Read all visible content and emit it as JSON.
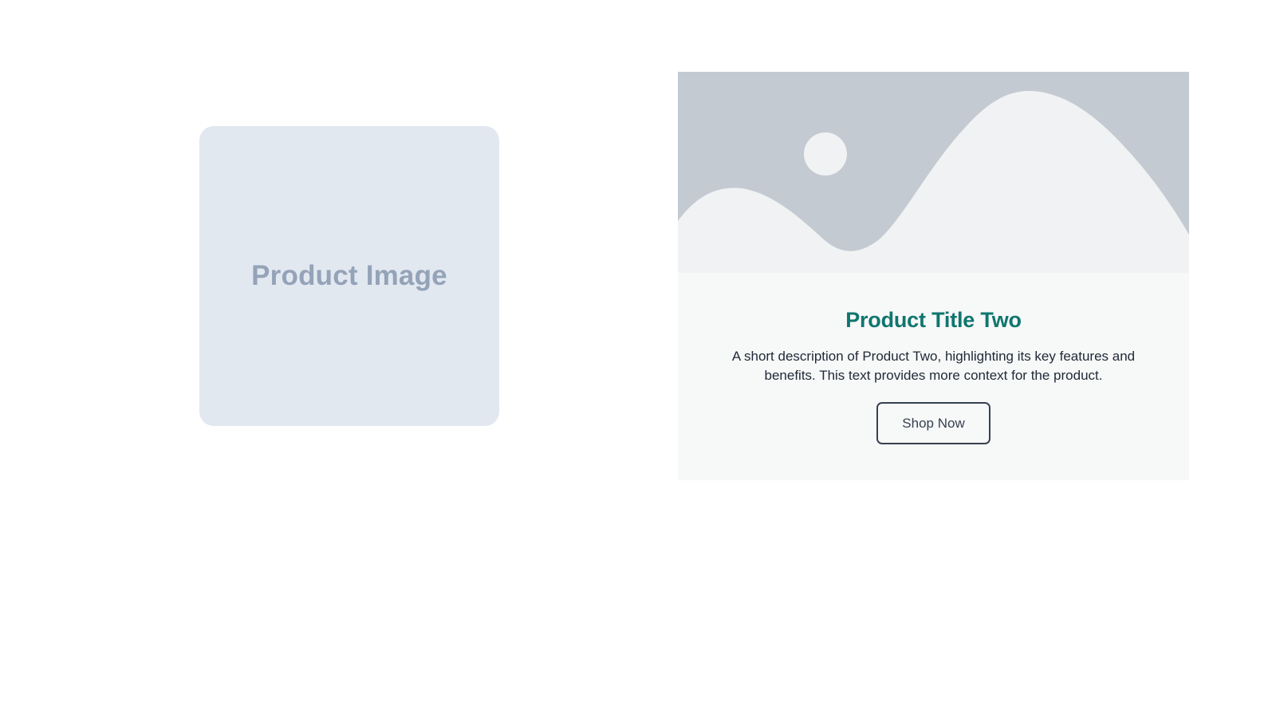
{
  "image_placeholder": {
    "label": "Product Image"
  },
  "product_card": {
    "title": "Product Title Two",
    "description": "A short description of Product Two, highlighting its key features and benefits. This text provides more context for the product.",
    "button_label": "Shop Now"
  },
  "colors": {
    "placeholder_bg": "#e2e8f0",
    "placeholder_text": "#94a3b8",
    "card_bg": "#f7f8f8",
    "image_sky": "#c3cad1",
    "image_hills": "#f1f2f3",
    "title": "#0f766e",
    "body_text": "#1f2937",
    "button_border": "#374151"
  },
  "icons": {
    "card_image": "landscape-placeholder-icon"
  }
}
